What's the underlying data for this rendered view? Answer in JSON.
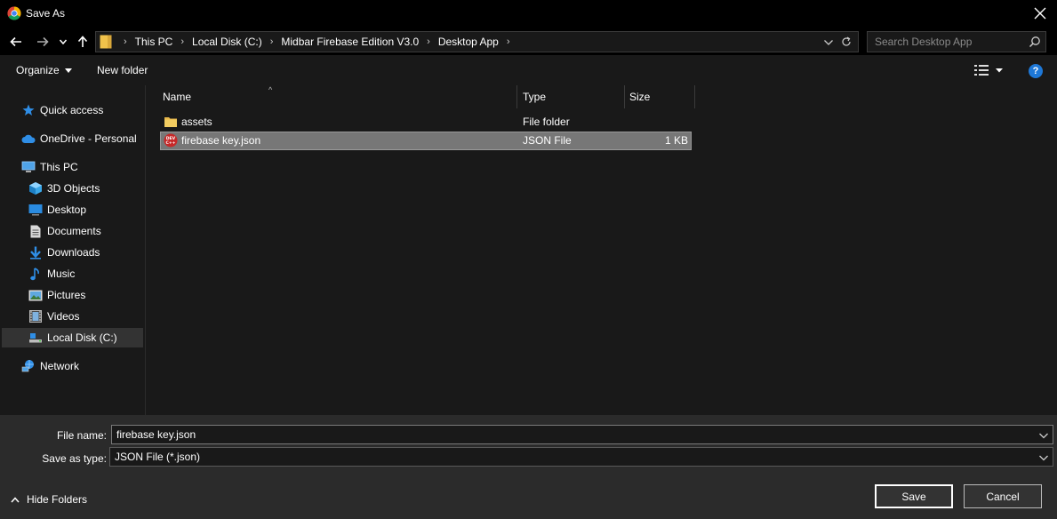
{
  "window": {
    "title": "Save As",
    "icons": {
      "app": "chrome-icon",
      "close": "close-icon"
    }
  },
  "nav": {
    "back_icon": "back-arrow-icon",
    "forward_icon": "forward-arrow-icon",
    "recent_icon": "chevron-down-icon",
    "up_icon": "up-arrow-icon",
    "breadcrumbs": [
      "This PC",
      "Local Disk (C:)",
      "Midbar Firebase Edition V3.0",
      "Desktop App"
    ],
    "search_placeholder": "Search Desktop App"
  },
  "toolbar": {
    "organize_label": "Organize",
    "new_folder_label": "New folder",
    "help_label": "?"
  },
  "sidebar": {
    "items": [
      {
        "label": "Quick access",
        "icon": "star-icon"
      },
      {
        "label": "OneDrive - Personal",
        "icon": "cloud-icon"
      },
      {
        "label": "This PC",
        "icon": "computer-icon"
      },
      {
        "label": "3D Objects",
        "icon": "cube-icon"
      },
      {
        "label": "Desktop",
        "icon": "desktop-icon"
      },
      {
        "label": "Documents",
        "icon": "document-icon"
      },
      {
        "label": "Downloads",
        "icon": "download-icon"
      },
      {
        "label": "Music",
        "icon": "music-icon"
      },
      {
        "label": "Pictures",
        "icon": "pictures-icon"
      },
      {
        "label": "Videos",
        "icon": "video-icon"
      },
      {
        "label": "Local Disk (C:)",
        "icon": "drive-icon",
        "selected": true
      },
      {
        "label": "Network",
        "icon": "network-icon"
      }
    ]
  },
  "file_list": {
    "columns": [
      "Name",
      "Type",
      "Size"
    ],
    "rows": [
      {
        "name": "assets",
        "type": "File folder",
        "size": "",
        "icon": "folder-icon"
      },
      {
        "name": "firebase key.json",
        "type": "JSON File",
        "size": "1 KB",
        "icon": "devcpp-file-icon",
        "selected": true
      }
    ]
  },
  "bottom": {
    "file_name_label": "File name:",
    "file_name_value": "firebase key.json",
    "save_type_label": "Save as type:",
    "save_type_value": "JSON File (*.json)",
    "hide_folders_label": "Hide Folders",
    "save_label": "Save",
    "cancel_label": "Cancel"
  },
  "colors": {
    "background": "#191919",
    "titlebar": "#000000",
    "bottom_panel": "#2b2b2b",
    "selection": "#777777",
    "accent": "#1e78d7",
    "folder": "#f0c24b"
  }
}
